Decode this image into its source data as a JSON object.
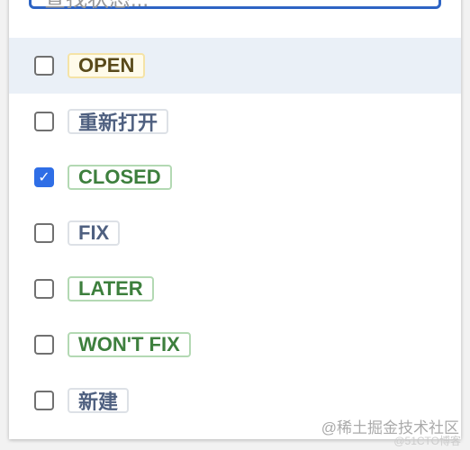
{
  "search": {
    "placeholder": "查找状态...",
    "icon": "search-icon"
  },
  "colors": {
    "accent": "#2f6ee6",
    "hover_row": "#eaf0f7"
  },
  "options": [
    {
      "label": "OPEN",
      "checked": false,
      "style": "yellow"
    },
    {
      "label": "重新打开",
      "checked": false,
      "style": "gray"
    },
    {
      "label": "CLOSED",
      "checked": true,
      "style": "green"
    },
    {
      "label": "FIX",
      "checked": false,
      "style": "gray"
    },
    {
      "label": "LATER",
      "checked": false,
      "style": "green"
    },
    {
      "label": "WON'T FIX",
      "checked": false,
      "style": "green"
    },
    {
      "label": "新建",
      "checked": false,
      "style": "gray"
    }
  ],
  "watermark": {
    "primary": "@稀土掘金技术社区",
    "secondary": "@51CTO博客"
  }
}
